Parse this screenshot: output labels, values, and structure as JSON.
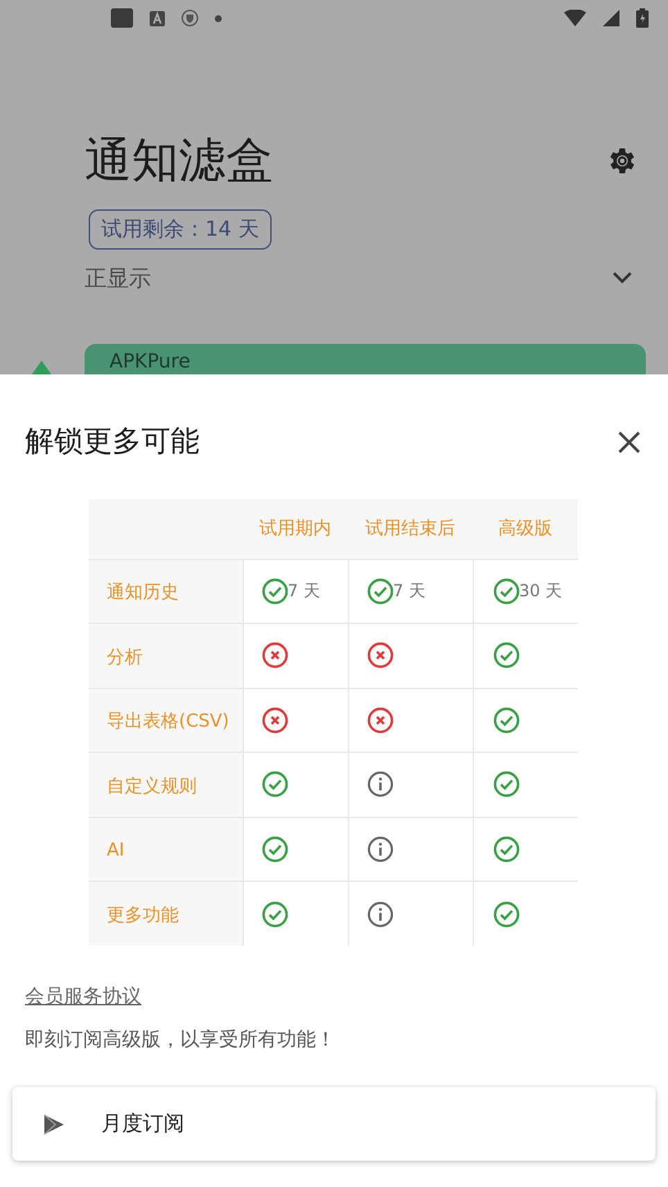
{
  "app": {
    "title": "通知滤盒",
    "trial_badge": "试用剩余：14 天",
    "section": {
      "label": "正显示",
      "expanded": false
    },
    "card": {
      "name": "APKPure"
    }
  },
  "sheet": {
    "title": "解锁更多可能",
    "table": {
      "columns": [
        "试用期内",
        "试用结束后",
        "高级版"
      ],
      "rows": [
        {
          "label": "通知历史",
          "cells": [
            {
              "kind": "check",
              "text": "7 天"
            },
            {
              "kind": "check",
              "text": "7 天"
            },
            {
              "kind": "check",
              "text": "30 天"
            }
          ]
        },
        {
          "label": "分析",
          "cells": [
            {
              "kind": "cross"
            },
            {
              "kind": "cross"
            },
            {
              "kind": "check"
            }
          ]
        },
        {
          "label": "导出表格(CSV)",
          "cells": [
            {
              "kind": "cross"
            },
            {
              "kind": "cross"
            },
            {
              "kind": "check"
            }
          ]
        },
        {
          "label": "自定义规则",
          "cells": [
            {
              "kind": "check"
            },
            {
              "kind": "info"
            },
            {
              "kind": "check"
            }
          ]
        },
        {
          "label": "AI",
          "cells": [
            {
              "kind": "check"
            },
            {
              "kind": "info"
            },
            {
              "kind": "check"
            }
          ]
        },
        {
          "label": "更多功能",
          "cells": [
            {
              "kind": "check"
            },
            {
              "kind": "info"
            },
            {
              "kind": "check"
            }
          ]
        }
      ]
    },
    "agreement_link": "会员服务协议",
    "description": "即刻订阅高级版，以享受所有功能！",
    "plans": [
      {
        "name": "月度订阅"
      }
    ]
  }
}
